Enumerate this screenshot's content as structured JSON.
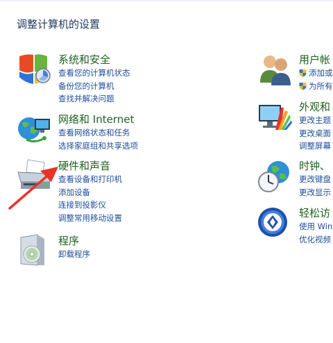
{
  "page_title": "调整计算机的设置",
  "left": {
    "system": {
      "title": "系统和安全",
      "links": [
        "查看您的计算机状态",
        "备份您的计算机",
        "查找并解决问题"
      ]
    },
    "network": {
      "title": "网络和 Internet",
      "links": [
        "查看网络状态和任务",
        "选择家庭组和共享选项"
      ]
    },
    "hardware": {
      "title": "硬件和声音",
      "links": [
        "查看设备和打印机",
        "添加设备",
        "连接到投影仪",
        "调整常用移动设置"
      ]
    },
    "programs": {
      "title": "程序",
      "links": [
        "卸载程序"
      ]
    }
  },
  "right": {
    "users": {
      "title": "用户帐",
      "links": [
        "添加或",
        "为所有"
      ]
    },
    "appearance": {
      "title": "外观和",
      "links": [
        "更改主题",
        "更改桌面",
        "调整屏幕"
      ]
    },
    "clock": {
      "title": "时钟、",
      "links": [
        "更改键盘",
        "更改显示"
      ]
    },
    "ease": {
      "title": "轻松访",
      "links": [
        "使用 Win",
        "优化视频"
      ]
    }
  },
  "colors": {
    "category_title": "#1e5f1e",
    "link": "#1e4d9a",
    "page_title": "#1e395b",
    "annotation_arrow": "#e8322c"
  },
  "icons": {
    "system": "shield-security-icon",
    "network": "network-globe-icon",
    "hardware": "printer-icon",
    "programs": "program-disc-box-icon",
    "users": "users-icon",
    "appearance": "monitor-palette-icon",
    "clock": "clock-globe-icon",
    "ease": "ease-of-access-icon"
  }
}
